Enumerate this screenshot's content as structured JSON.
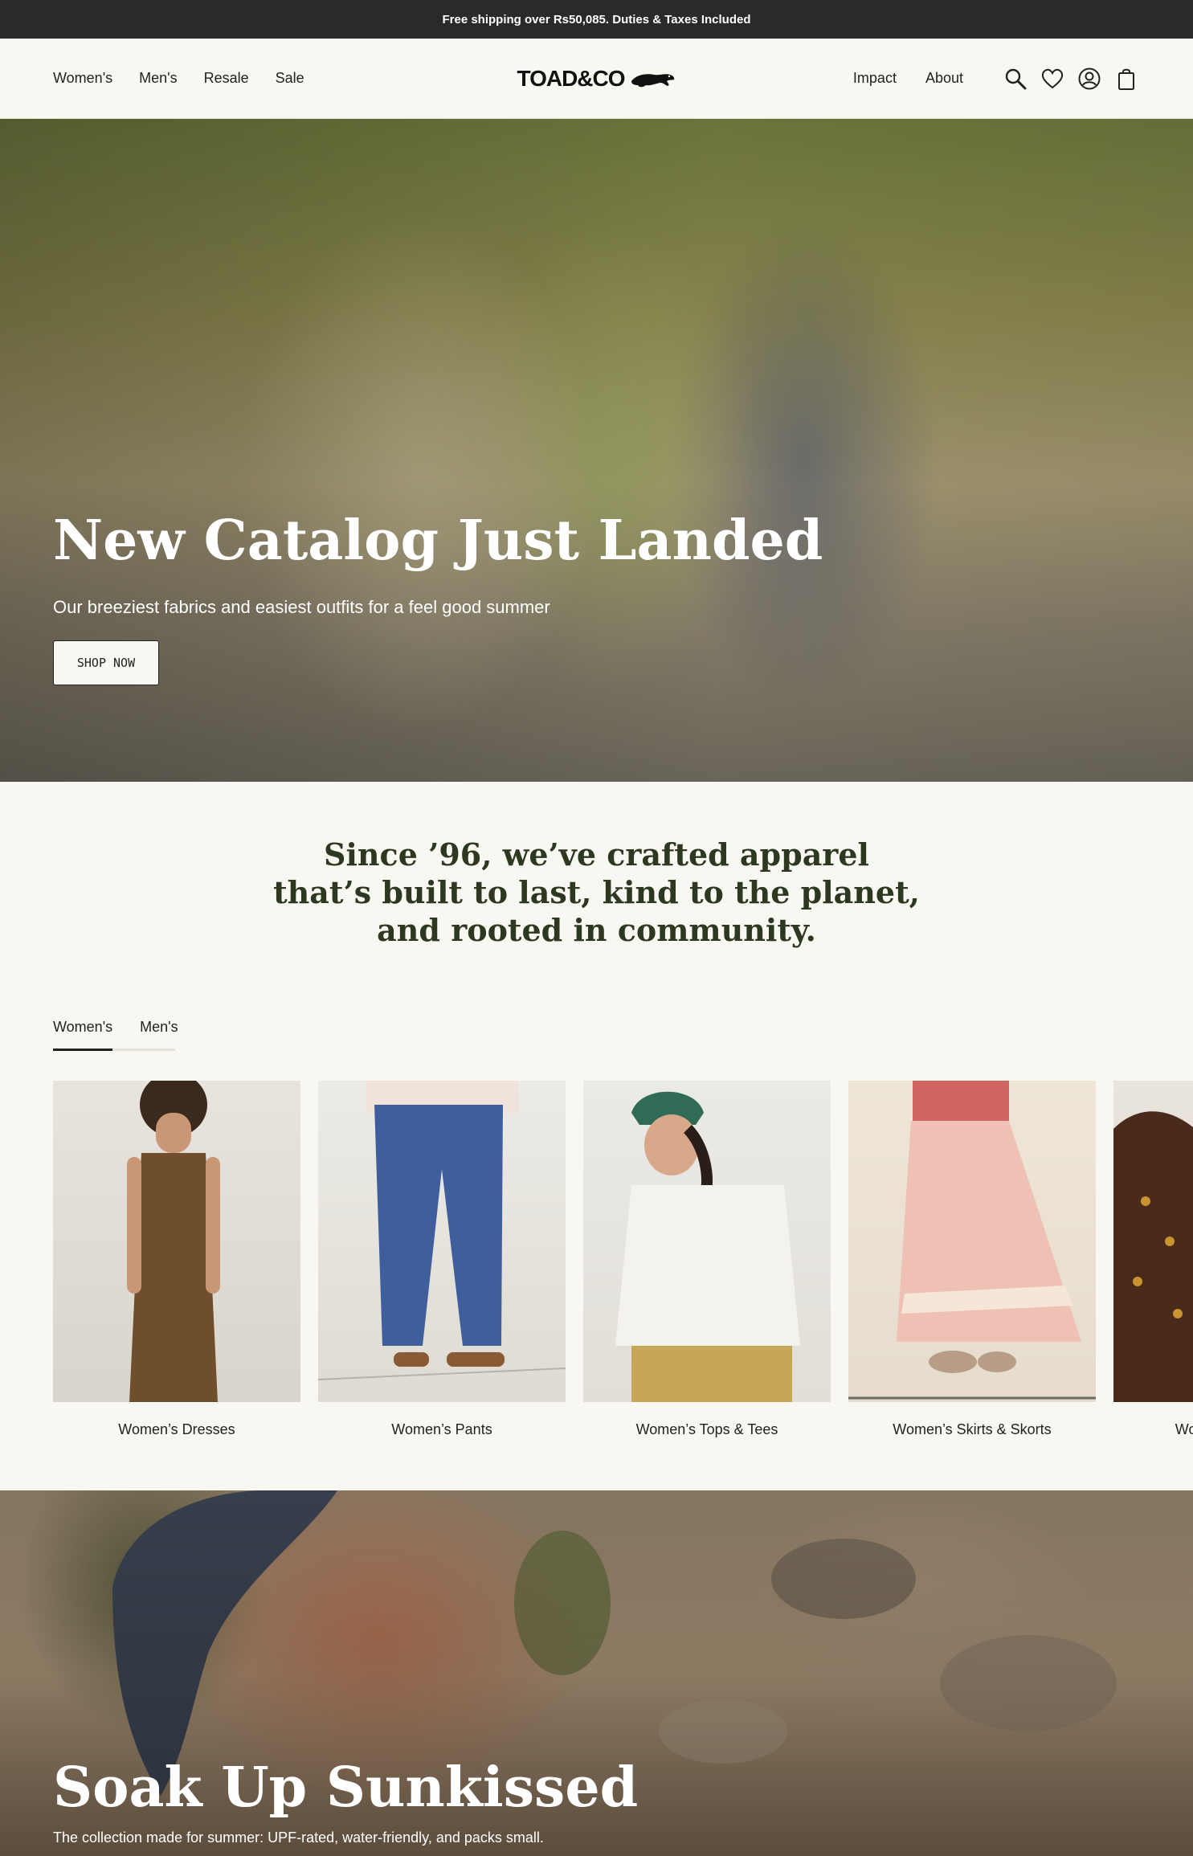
{
  "announcement": "Free shipping over Rs50,085. Duties & Taxes Included",
  "header": {
    "logo": "TOAD&CO",
    "nav_left": [
      "Women's",
      "Men's",
      "Resale",
      "Sale"
    ],
    "nav_right": [
      "Impact",
      "About"
    ],
    "icons": [
      "search-icon",
      "heart-icon",
      "account-icon",
      "bag-icon"
    ]
  },
  "hero": {
    "title": "New Catalog Just Landed",
    "subtitle": "Our breeziest fabrics and easiest outfits for a feel good summer",
    "cta": "SHOP NOW"
  },
  "mission": {
    "line1": "Since ’96, we’ve crafted apparel",
    "line2": "that’s built to last, kind to the planet,",
    "line3": "and rooted in community."
  },
  "tabs": [
    "Women's",
    "Men's"
  ],
  "categories": [
    {
      "label": "Women’s Dresses",
      "color": "#6f4e2c"
    },
    {
      "label": "Women’s Pants",
      "color": "#3f5f9c"
    },
    {
      "label": "Women’s Tops & Tees",
      "color": "#f2f0ea"
    },
    {
      "label": "Women’s Skirts & Skorts",
      "color": "#efc0b4"
    },
    {
      "label": "Women’s Sweaters",
      "color": "#4a2a1b"
    }
  ],
  "promo": {
    "title": "Soak Up Sunkissed",
    "subtitle": "The collection made for summer: UPF-rated, water-friendly, and packs small."
  }
}
